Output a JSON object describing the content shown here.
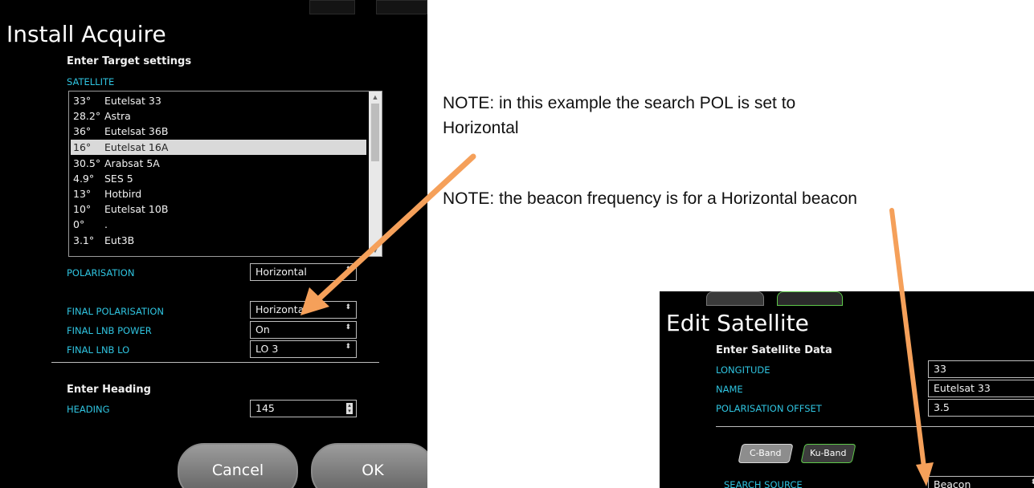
{
  "left_panel": {
    "title": "Install Acquire",
    "subtitle": "Enter Target settings",
    "satellite_label": "SATELLITE",
    "satellites": [
      {
        "deg": "33°",
        "name": "Eutelsat 33"
      },
      {
        "deg": "28.2°",
        "name": "Astra"
      },
      {
        "deg": "36°",
        "name": "Eutelsat 36B"
      },
      {
        "deg": "16°",
        "name": "Eutelsat 16A"
      },
      {
        "deg": "30.5°",
        "name": "Arabsat 5A"
      },
      {
        "deg": "4.9°",
        "name": "SES 5"
      },
      {
        "deg": "13°",
        "name": "Hotbird"
      },
      {
        "deg": "10°",
        "name": "Eutelsat 10B"
      },
      {
        "deg": "0°",
        "name": "."
      },
      {
        "deg": "3.1°",
        "name": "Eut3B"
      }
    ],
    "selected_index": 3,
    "polarisation_label": "POLARISATION",
    "polarisation_value": "Horizontal",
    "final_polarisation_label": "FINAL POLARISATION",
    "final_polarisation_value": "Horizontal",
    "final_lnb_power_label": "FINAL LNB POWER",
    "final_lnb_power_value": "On",
    "final_lnb_lo_label": "FINAL LNB LO",
    "final_lnb_lo_value": "LO 3",
    "heading_section": "Enter Heading",
    "heading_label": "HEADING",
    "heading_value": "145",
    "cancel_label": "Cancel",
    "ok_label": "OK"
  },
  "right_panel": {
    "title": "Edit Satellite",
    "subtitle": "Enter Satellite Data",
    "longitude_label": "LONGITUDE",
    "longitude_value": "33",
    "name_label": "NAME",
    "name_value": "Eutelsat 33",
    "pol_offset_label": "POLARISATION OFFSET",
    "pol_offset_value": "3.5",
    "tab_c_band": "C-Band",
    "tab_ku_band": "Ku-Band",
    "search_source_label": "SEARCH SOURCE",
    "search_source_value": "Beacon"
  },
  "notes": {
    "note1": "NOTE: in this example the search POL is set to Horizontal",
    "note2": "NOTE: the beacon frequency is for a Horizontal beacon"
  },
  "colors": {
    "label_cyan": "#2fc4e0",
    "arrow_orange": "#f5a05a",
    "ku_green": "#5ec94a"
  }
}
